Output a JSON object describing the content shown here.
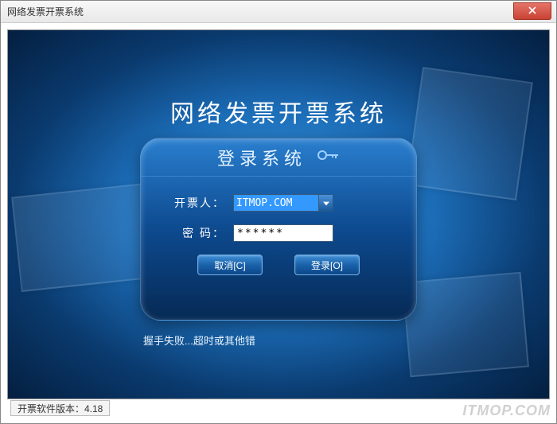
{
  "window": {
    "title": "网络发票开票系统"
  },
  "app": {
    "title": "网络发票开票系统"
  },
  "login": {
    "panel_title": "登录系统",
    "operator_label": "开票人：",
    "operator_value": "ITMOP.COM",
    "password_label": "密  码：",
    "password_value": "******",
    "cancel_label": "取消[C]",
    "login_label": "登录[O]"
  },
  "status_text": "握手失败...超时或其他错",
  "footer": {
    "version_text": "开票软件版本：4.18"
  },
  "watermark": "ITMOP.COM"
}
